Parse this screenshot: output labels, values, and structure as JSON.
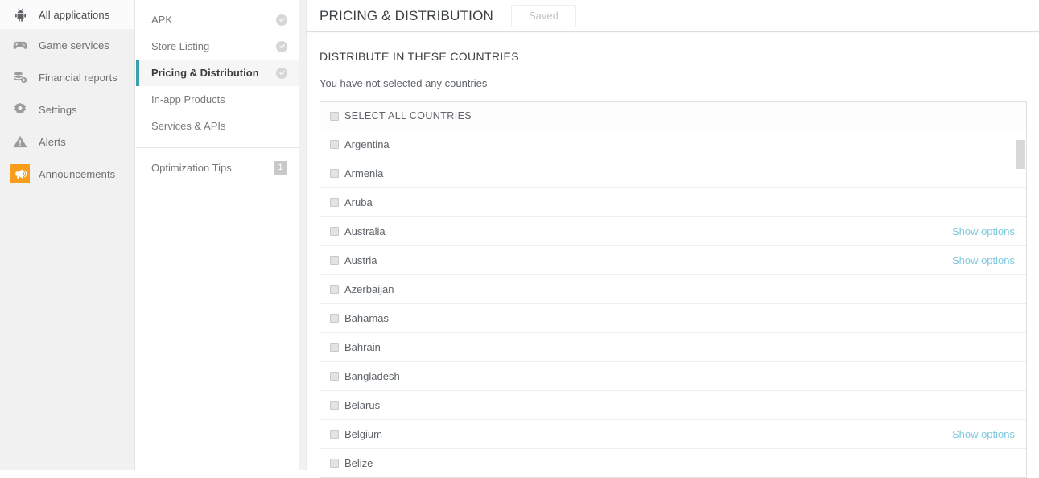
{
  "primary_nav": {
    "items": [
      {
        "label": "All applications",
        "icon": "android-icon",
        "current": true
      },
      {
        "label": "Game services",
        "icon": "gamepad-icon",
        "current": false
      },
      {
        "label": "Financial reports",
        "icon": "coins-icon",
        "current": false
      },
      {
        "label": "Settings",
        "icon": "gear-icon",
        "current": false
      },
      {
        "label": "Alerts",
        "icon": "warning-triangle-icon",
        "current": false
      },
      {
        "label": "Announcements",
        "icon": "megaphone-icon",
        "current": false
      }
    ]
  },
  "secondary_nav": {
    "items": [
      {
        "label": "APK",
        "status": "check",
        "active": false
      },
      {
        "label": "Store Listing",
        "status": "check",
        "active": false
      },
      {
        "label": "Pricing & Distribution",
        "status": "check",
        "active": true
      },
      {
        "label": "In-app Products",
        "status": "",
        "active": false
      },
      {
        "label": "Services & APIs",
        "status": "",
        "active": false
      }
    ],
    "tips": {
      "label": "Optimization Tips",
      "badge": "1"
    }
  },
  "header": {
    "title": "PRICING & DISTRIBUTION",
    "save_label": "Saved"
  },
  "main": {
    "section_title": "DISTRIBUTE IN THESE COUNTRIES",
    "note": "You have not selected any countries",
    "select_all_label": "SELECT ALL COUNTRIES",
    "show_options_label": "Show options",
    "countries": [
      {
        "name": "Argentina",
        "options": false
      },
      {
        "name": "Armenia",
        "options": false
      },
      {
        "name": "Aruba",
        "options": false
      },
      {
        "name": "Australia",
        "options": true
      },
      {
        "name": "Austria",
        "options": true
      },
      {
        "name": "Azerbaijan",
        "options": false
      },
      {
        "name": "Bahamas",
        "options": false
      },
      {
        "name": "Bahrain",
        "options": false
      },
      {
        "name": "Bangladesh",
        "options": false
      },
      {
        "name": "Belarus",
        "options": false
      },
      {
        "name": "Belgium",
        "options": true
      },
      {
        "name": "Belize",
        "options": false
      }
    ]
  },
  "colors": {
    "accent_teal": "#3b9fad",
    "link_blue": "#7ec8de",
    "announcement_orange": "#f89c1c",
    "sidebar_bg": "#f1f1f1"
  }
}
